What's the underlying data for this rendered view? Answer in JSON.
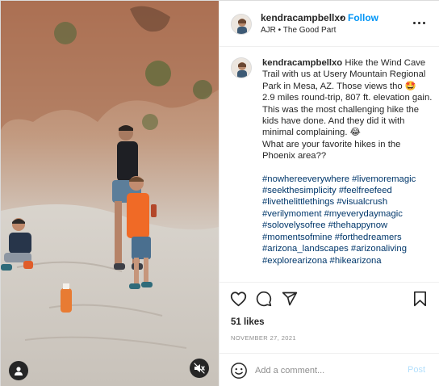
{
  "post": {
    "username": "kendracampbellxo",
    "dot": "•",
    "follow_label": "Follow",
    "audio": "AJR • The Good Part"
  },
  "caption": {
    "username": "kendracampbellxo",
    "line1": "Hike the Wind Cave Trail with us at Usery Mountain Regional Park in Mesa, AZ. Those views tho 🤩",
    "line2": "2.9 miles round-trip, 807 ft. elevation gain. This was the most challenging hike the kids have done. And they did it with minimal complaining. 😂",
    "line3": "What are your favorite hikes in the Phoenix area??",
    "hashtags": [
      "#nowhereeverywhere",
      "#livemoremagic",
      "#seekthesimplicity",
      "#feelfreefeed",
      "#livethelittlethings",
      "#visualcrush",
      "#verilymoment",
      "#myeverydaymagic",
      "#solovelysofree",
      "#thehappynow",
      "#momentsofmine",
      "#forthedreamers",
      "#arizona_landscapes",
      "#arizonaliving",
      "#explorearizona",
      "#hikearizona"
    ]
  },
  "stats": {
    "likes": "51 likes",
    "date": "NOVEMBER 27, 2021"
  },
  "comment": {
    "placeholder": "Add a comment...",
    "post_label": "Post"
  },
  "icons": {
    "heart": "heart-icon",
    "comment": "comment-icon",
    "share": "share-icon",
    "save": "bookmark-icon",
    "emoji": "emoji-icon",
    "more": "more-icon",
    "user": "user-icon",
    "mute": "muted-speaker-icon"
  },
  "colors": {
    "accent": "#0095f6",
    "hashtag": "#00376b",
    "muted": "#8e8e8e",
    "post_disabled": "#b2dffc"
  }
}
